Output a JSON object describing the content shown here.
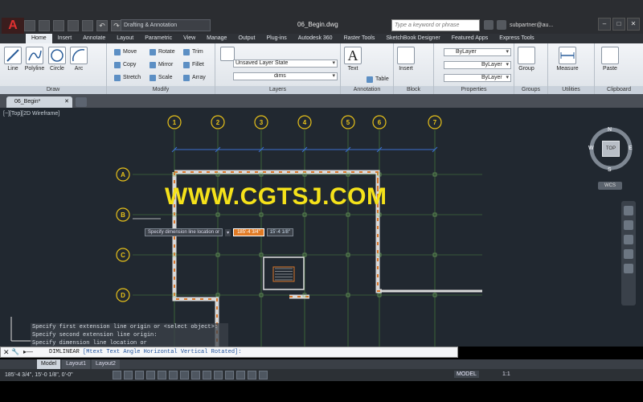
{
  "app": {
    "logo_letter": "A",
    "workspace": "Drafting & Annotation",
    "doc_title": "06_Begin.dwg",
    "search_placeholder": "Type a keyword or phrase",
    "user": "subpartner@au..."
  },
  "ribbon_tabs": [
    "Home",
    "Insert",
    "Annotate",
    "Layout",
    "Parametric",
    "View",
    "Manage",
    "Output",
    "Plug-ins",
    "Autodesk 360",
    "Raster Tools",
    "SketchBook Designer",
    "Featured Apps",
    "Express Tools"
  ],
  "ribbon": {
    "draw": {
      "label": "Draw",
      "tools": [
        "Line",
        "Polyline",
        "Circle",
        "Arc"
      ]
    },
    "modify": {
      "label": "Modify",
      "tools": [
        "Move",
        "Rotate",
        "Trim",
        "Copy",
        "Mirror",
        "Fillet",
        "Stretch",
        "Scale",
        "Array"
      ]
    },
    "layers": {
      "label": "Layers",
      "state": "Unsaved Layer State",
      "current": "dims"
    },
    "annotation": {
      "label": "Annotation",
      "text": "Text",
      "table": "Table"
    },
    "block": {
      "label": "Block",
      "insert": "Insert"
    },
    "properties": {
      "label": "Properties",
      "color": "ByLayer",
      "linetype": "ByLayer",
      "lineweight": "ByLayer"
    },
    "groups": {
      "label": "Groups",
      "group": "Group"
    },
    "utilities": {
      "label": "Utilities",
      "measure": "Measure"
    },
    "clipboard": {
      "label": "Clipboard",
      "paste": "Paste"
    }
  },
  "doc_tab": "06_Begin*",
  "viewport": {
    "label": "[−][Top][2D Wireframe]",
    "watermark": "WWW.CGTSJ.COM",
    "dim_prompt": "Specify dimension line location or",
    "dim_value": "185'-4 3/4\"",
    "dim_angle": "15'-4 1/8\"",
    "grid_columns": [
      "1",
      "2",
      "3",
      "4",
      "5",
      "6",
      "7"
    ],
    "grid_rows": [
      "A",
      "B",
      "C",
      "D"
    ],
    "viewcube": {
      "n": "N",
      "s": "S",
      "e": "E",
      "w": "W",
      "face": "TOP",
      "wcs": "WCS"
    }
  },
  "command": {
    "history": [
      "Specify first extension line origin or <select object>:",
      "Specify second extension line origin:",
      "Specify dimension line location or"
    ],
    "current": "DIMLINEAR",
    "options": "[Mtext Text Angle Horizontal Vertical Rotated]:"
  },
  "layout_tabs": [
    "Model",
    "Layout1",
    "Layout2"
  ],
  "status": {
    "coords": "185'-4 3/4\", 15'-0 1/8\", 0'-0\"",
    "model": "MODEL",
    "scale": "1:1"
  }
}
